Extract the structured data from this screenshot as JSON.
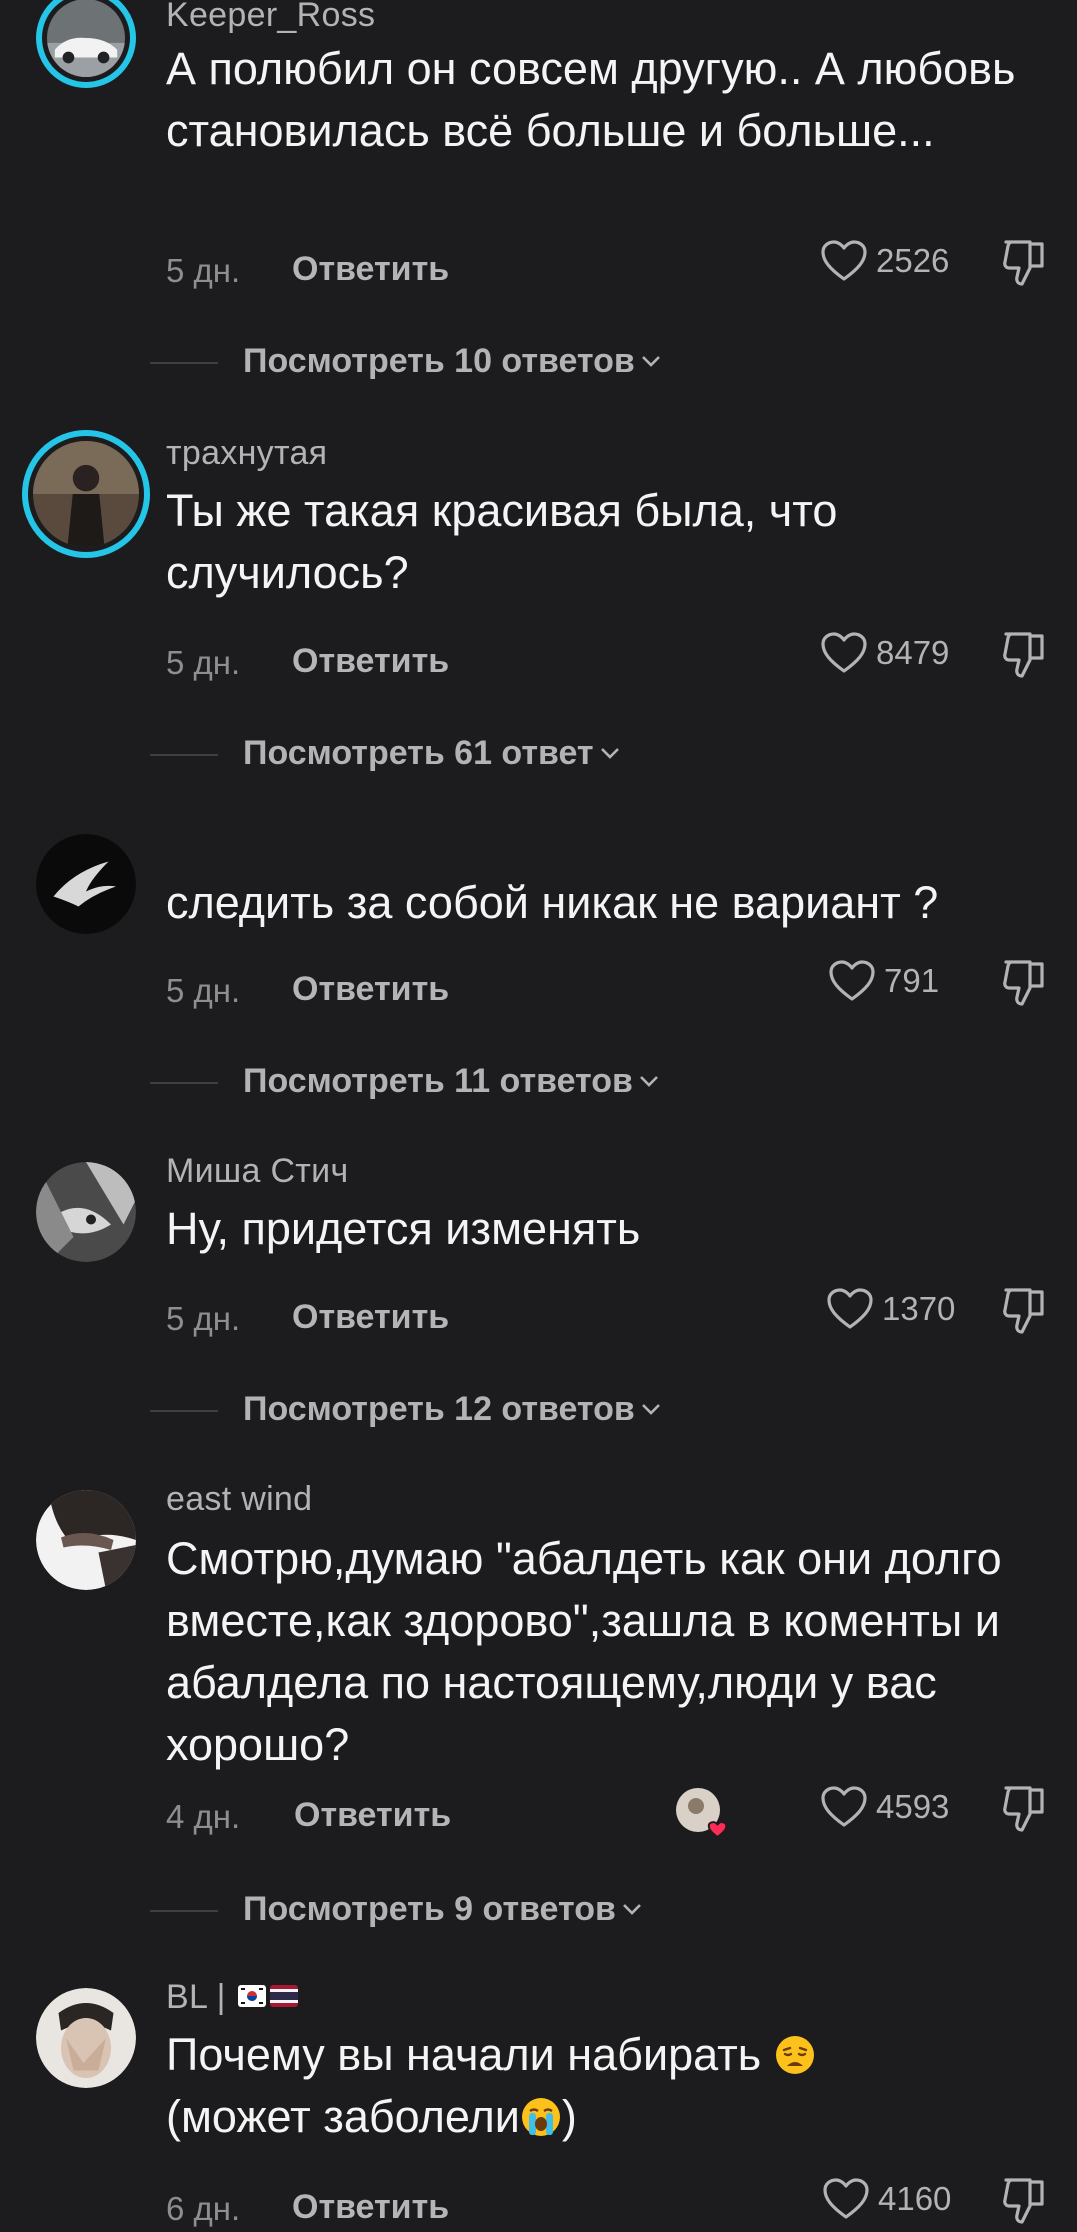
{
  "common": {
    "reply_label": "Ответить"
  },
  "comments": [
    {
      "username": "Keeper_Ross",
      "text": "А полюбил он совсем другую.. А любовь становилась всё больше и больше...",
      "date": "5 дн.",
      "likes": "2526",
      "view_replies": "Посмотреть 10 ответов"
    },
    {
      "username": "трахнутая",
      "text": "Ты же такая красивая была, что случилось?",
      "date": "5 дн.",
      "likes": "8479",
      "view_replies": "Посмотреть 61 ответ"
    },
    {
      "username": "",
      "text": "следить за собой никак не вариант ?",
      "date": "5 дн.",
      "likes": "791",
      "view_replies": "Посмотреть 11 ответов"
    },
    {
      "username": "Миша Стич",
      "text": "Ну, придется изменять",
      "date": "5 дн.",
      "likes": "1370",
      "view_replies": "Посмотреть 12 ответов"
    },
    {
      "username": "east wind",
      "text": "Смотрю,думаю \"абалдеть как они долго вместе,как здорово\",зашла в коменты и абалдела по настоящему,люди у вас хорошо?",
      "date": "4 дн.",
      "likes": "4593",
      "view_replies": "Посмотреть 9 ответов"
    },
    {
      "username": "BL |",
      "text": "Почему вы начали набирать",
      "text_line2": "(может заболели",
      "text_end": ")",
      "date": "6 дн.",
      "likes": "4160"
    }
  ],
  "colors": {
    "background": "#1c1c1e",
    "avatar_ring": "#25c5e8",
    "text_primary": "#f4f4f5",
    "text_secondary": "#b3b3b6"
  }
}
